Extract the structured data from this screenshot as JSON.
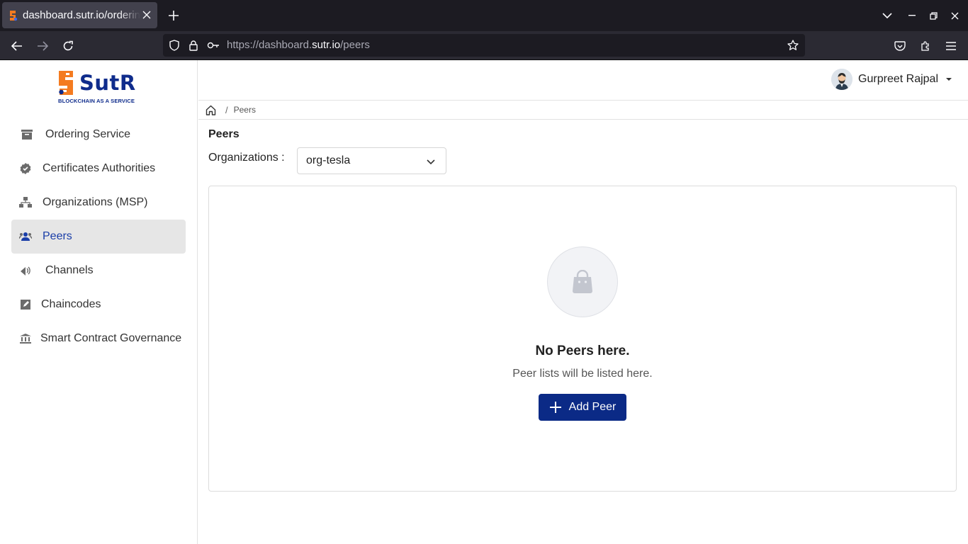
{
  "browser": {
    "tab_title": "dashboard.sutr.io/ordering",
    "url_prefix": "https://dashboard.",
    "url_host": "sutr.io",
    "url_path": "/peers"
  },
  "brand": {
    "name": "SutR",
    "tagline": "BLOCKCHAIN AS A SERVICE",
    "primary_color": "#0f2c8c",
    "accent_color": "#f47b20"
  },
  "sidebar": {
    "items": [
      {
        "label": "Ordering Service",
        "icon": "inbox-icon",
        "active": false
      },
      {
        "label": "Certificates Authorities",
        "icon": "verified-badge-icon",
        "active": false
      },
      {
        "label": "Organizations (MSP)",
        "icon": "hierarchy-icon",
        "active": false
      },
      {
        "label": "Peers",
        "icon": "peers-icon",
        "active": true
      },
      {
        "label": "Channels",
        "icon": "broadcast-icon",
        "active": false
      },
      {
        "label": "Chaincodes",
        "icon": "edit-box-icon",
        "active": false
      },
      {
        "label": "Smart Contract Governance",
        "icon": "bank-icon",
        "active": false
      }
    ]
  },
  "header": {
    "user_name": "Gurpreet Rajpal"
  },
  "breadcrumb": {
    "current": "Peers",
    "separator": "/"
  },
  "page": {
    "title": "Peers",
    "org_label": "Organizations :",
    "org_selected": "org-tesla",
    "empty_title": "No Peers here.",
    "empty_subtitle": "Peer lists will be listed here.",
    "add_button": "Add Peer",
    "button_color": "#0b2a86"
  }
}
